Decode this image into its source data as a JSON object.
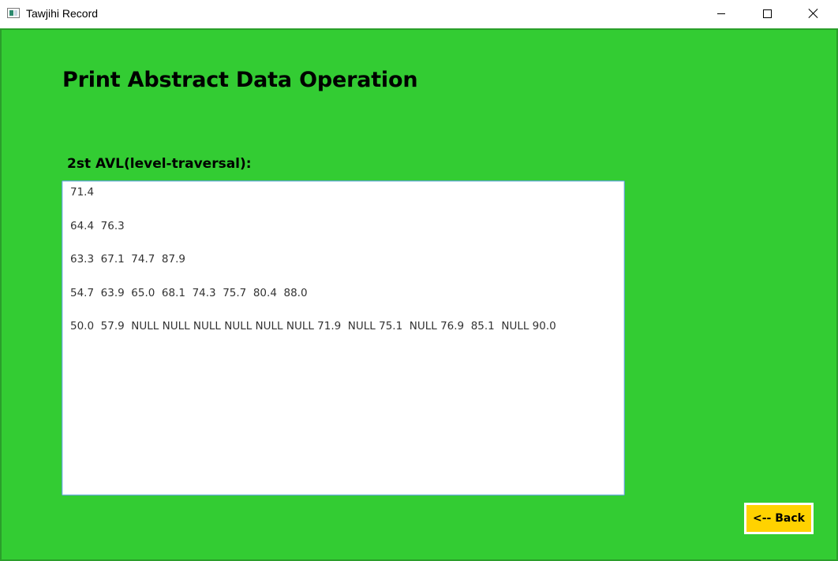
{
  "window": {
    "title": "Tawjihi Record",
    "icon": "app-window-icon",
    "controls": {
      "minimize": "minimize-icon",
      "maximize": "maximize-icon",
      "close": "close-icon"
    }
  },
  "page": {
    "heading": "Print Abstract Data Operation",
    "section_label": "2st AVL(level-traversal):",
    "background_color": "#33cc33"
  },
  "output": {
    "lines": [
      "71.4",
      "64.4  76.3",
      "63.3  67.1  74.7  87.9",
      "54.7  63.9  65.0  68.1  74.3  75.7  80.4  88.0",
      "50.0  57.9  NULL NULL NULL NULL NULL NULL 71.9  NULL 75.1  NULL 76.9  85.1  NULL 90.0"
    ]
  },
  "actions": {
    "back_label": "<-- Back",
    "back_color": "#ffd200"
  }
}
